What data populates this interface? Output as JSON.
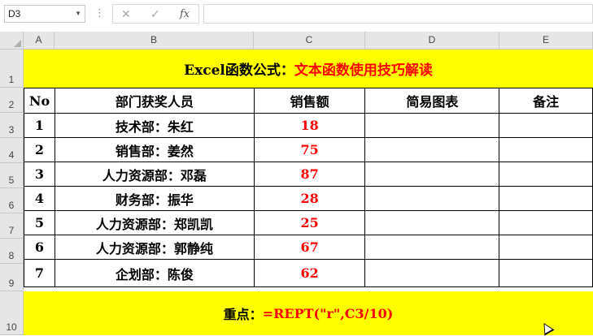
{
  "formula_bar": {
    "name_box": "D3",
    "cancel_icon": "✕",
    "enter_icon": "✓",
    "fx_label": "fx",
    "formula": ""
  },
  "columns": [
    "A",
    "B",
    "C",
    "D",
    "E"
  ],
  "rows": [
    "1",
    "2",
    "3",
    "4",
    "5",
    "6",
    "7",
    "8",
    "9",
    "10"
  ],
  "title": {
    "black": "Excel函数公式：",
    "red": "文本函数使用技巧解读"
  },
  "table": {
    "headers": [
      "No",
      "部门获奖人员",
      "销售额",
      "简易图表",
      "备注"
    ],
    "rows": [
      {
        "no": "1",
        "name": "技术部：朱红",
        "sales": "18",
        "chart": "",
        "note": ""
      },
      {
        "no": "2",
        "name": "销售部：姜然",
        "sales": "75",
        "chart": "",
        "note": ""
      },
      {
        "no": "3",
        "name": "人力资源部：邓磊",
        "sales": "87",
        "chart": "",
        "note": ""
      },
      {
        "no": "4",
        "name": "财务部：振华",
        "sales": "28",
        "chart": "",
        "note": ""
      },
      {
        "no": "5",
        "name": "人力资源部：郑凯凯",
        "sales": "25",
        "chart": "",
        "note": ""
      },
      {
        "no": "6",
        "name": "人力资源部：郭静纯",
        "sales": "67",
        "chart": "",
        "note": ""
      },
      {
        "no": "7",
        "name": "企划部：陈俊",
        "sales": "62",
        "chart": "",
        "note": ""
      }
    ]
  },
  "note": {
    "black": "重点：",
    "red": "=REPT(\"r\",C3/10)"
  },
  "colors": {
    "band": "#ffff00",
    "accent": "#ff0000"
  }
}
